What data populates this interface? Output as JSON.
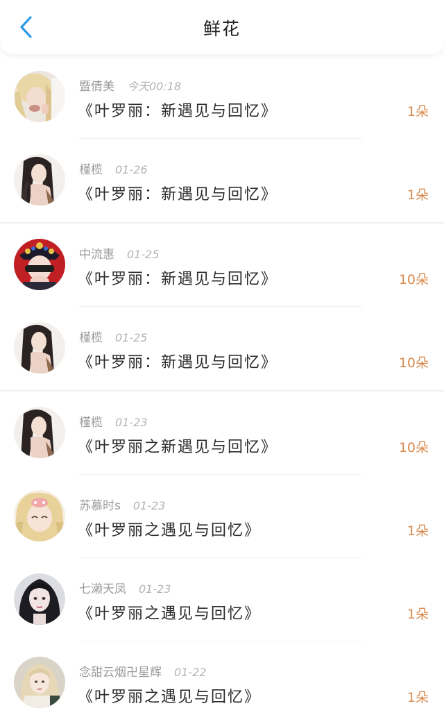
{
  "header": {
    "title": "鲜花"
  },
  "icons": {
    "back": "chevron-left-icon",
    "back_color": "#2b9be8"
  },
  "colors": {
    "count": "#d98a4e",
    "name": "#9a9a9a",
    "work": "#2a2a2a"
  },
  "items": [
    {
      "name": "暨倩美",
      "time": "今天00:18",
      "work": "《叶罗丽：新遇见与回忆》",
      "count": "1朵",
      "avatar": "avatar-blonde-hair"
    },
    {
      "name": "槿榄",
      "time": "01-26",
      "work": "《叶罗丽：新遇见与回忆》",
      "count": "1朵",
      "avatar": "avatar-dark-hair"
    },
    {
      "name": "中流惠",
      "time": "01-25",
      "work": "《叶罗丽：新遇见与回忆》",
      "count": "10朵",
      "avatar": "avatar-red-crown"
    },
    {
      "name": "槿榄",
      "time": "01-25",
      "work": "《叶罗丽：新遇见与回忆》",
      "count": "10朵",
      "avatar": "avatar-dark-hair"
    },
    {
      "name": "槿榄",
      "time": "01-23",
      "work": "《叶罗丽之新遇见与回忆》",
      "count": "10朵",
      "avatar": "avatar-dark-hair"
    },
    {
      "name": "苏慕时s",
      "time": "01-23",
      "work": "《叶罗丽之遇见与回忆》",
      "count": "1朵",
      "avatar": "avatar-anime-blonde"
    },
    {
      "name": "七濑天凤",
      "time": "01-23",
      "work": "《叶罗丽之遇见与回忆》",
      "count": "1朵",
      "avatar": "avatar-black-hair"
    },
    {
      "name": "念甜云烟卍星辉",
      "time": "01-22",
      "work": "《叶罗丽之遇见与回忆》",
      "count": "1朵",
      "avatar": "avatar-light-hair"
    }
  ]
}
